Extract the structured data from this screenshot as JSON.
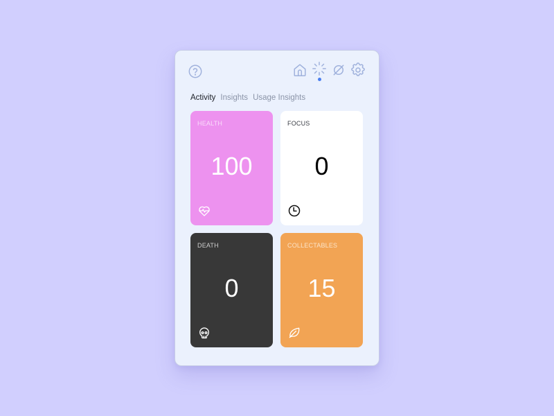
{
  "header": {
    "help_icon": "help-circle-icon",
    "nav": [
      {
        "name": "home",
        "icon": "home-icon",
        "active": false
      },
      {
        "name": "loader",
        "icon": "loader-icon",
        "active": true
      },
      {
        "name": "null",
        "icon": "null-icon",
        "active": false
      },
      {
        "name": "settings",
        "icon": "gear-icon",
        "active": false
      }
    ],
    "active_indicator_color": "#4a7ef0"
  },
  "tabs": [
    {
      "label": "Activity",
      "active": true
    },
    {
      "label": "Insights",
      "active": false
    },
    {
      "label": "Usage Insights",
      "active": false
    }
  ],
  "cards": [
    {
      "label": "HEALTH",
      "value": "100",
      "icon": "heart-pulse-icon",
      "color": "#ed92ef"
    },
    {
      "label": "FOCUS",
      "value": "0",
      "icon": "clock-icon",
      "color": "#ffffff"
    },
    {
      "label": "DEATH",
      "value": "0",
      "icon": "skull-icon",
      "color": "#383838"
    },
    {
      "label": "COLLECTABLES",
      "value": "15",
      "icon": "leaf-icon",
      "color": "#f2a454"
    }
  ]
}
